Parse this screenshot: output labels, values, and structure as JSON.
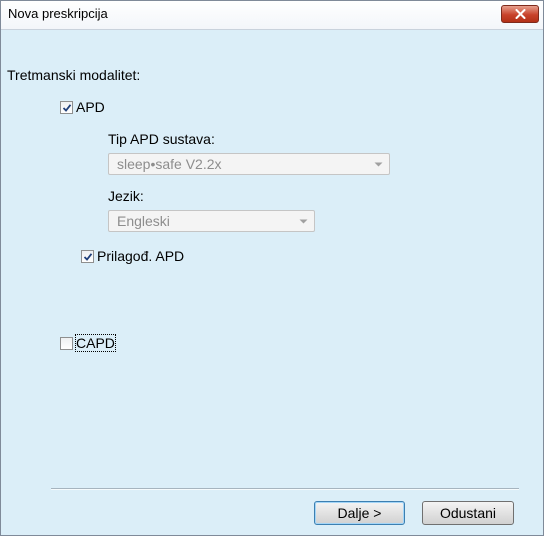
{
  "window": {
    "title": "Nova preskripcija"
  },
  "treatment": {
    "label": "Tretmanski modalitet:",
    "apd": {
      "label": "APD",
      "checked": true,
      "system_type_label": "Tip APD sustava:",
      "system_type_value": "sleep•safe V2.2x",
      "language_label": "Jezik:",
      "language_value": "Engleski",
      "custom_apd": {
        "label": "Prilagođ. APD",
        "checked": true
      }
    },
    "capd": {
      "label": "CAPD",
      "checked": false
    }
  },
  "footer": {
    "next_label": "Dalje >",
    "cancel_label": "Odustani"
  },
  "colors": {
    "dialog_background": "#dbeef8",
    "disabled_text": "#8d8d8d",
    "close_button": "#c8422b"
  }
}
